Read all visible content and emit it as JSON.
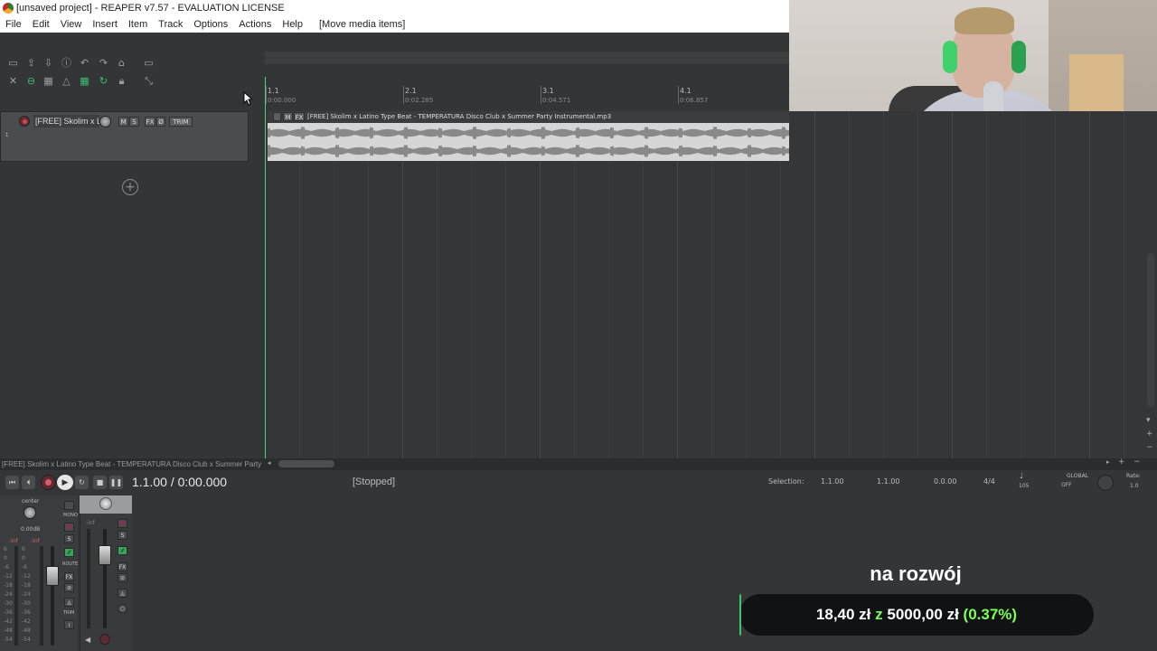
{
  "window": {
    "title": "[unsaved project] - REAPER v7.57 - EVALUATION LICENSE"
  },
  "menu": [
    "File",
    "Edit",
    "View",
    "Insert",
    "Item",
    "Track",
    "Options",
    "Actions",
    "Help",
    "[Move media items]"
  ],
  "ruler": {
    "bars": [
      {
        "bar": "1.1",
        "time": "0:00.000"
      },
      {
        "bar": "2.1",
        "time": "0:02.285"
      },
      {
        "bar": "3.1",
        "time": "0:04.571"
      },
      {
        "bar": "4.1",
        "time": "0:06.857"
      }
    ]
  },
  "track": {
    "number": "1",
    "name": "[FREE] Skolim x La",
    "buttons": {
      "mute": "M",
      "solo": "S",
      "fx": "FX",
      "phase": "Ø",
      "trim": "TRIM"
    }
  },
  "media_item": {
    "name": "[FREE] Skolim x Latino Type Beat - TEMPERATURA  Disco Club x Summer Party Instrumental.mp3",
    "flags": [
      "M",
      "FX"
    ]
  },
  "status": {
    "media_strip": "[FREE] Skolim x Latino Type Beat - TEMPERATURA  Disco Club x Summer Party Ins"
  },
  "transport": {
    "position": "1.1.00 / 0:00.000",
    "state": "[Stopped]",
    "selection_label": "Selection:",
    "selection_start": "1.1.00",
    "selection_end": "1.1.00",
    "selection_length": "0.0.00",
    "time_signature": "4/4",
    "bpm": "105",
    "global_label": "GLOBAL",
    "global_state": "OFF",
    "rate_label": "Rate:",
    "rate_value": "1.0"
  },
  "mixer": {
    "master": {
      "pan": "center",
      "volume": "0.00dB",
      "peak_l": "-inf",
      "peak_r": "-inf",
      "mono": "MONO",
      "route": "ROUTE",
      "fx": "FX",
      "trim": "TRIM",
      "mute": "M",
      "solo": "S"
    },
    "track": {
      "peak": "-inf",
      "mute": "M",
      "solo": "S",
      "fx": "FX"
    },
    "scale": [
      "6",
      "0",
      "-6",
      "-12",
      "-18",
      "-24",
      "-30",
      "-36",
      "-42",
      "-48",
      "-54"
    ]
  },
  "overlay": {
    "donation_title": "na rozwój",
    "amount": "18,40 zł",
    "separator": "z",
    "goal": "5000,00 zł",
    "percent": "(0.37%)",
    "progress_fraction": 0.0037
  },
  "colors": {
    "accent_green": "#7cff53",
    "playhead": "#4dd18b",
    "record_red": "#e0596a"
  }
}
